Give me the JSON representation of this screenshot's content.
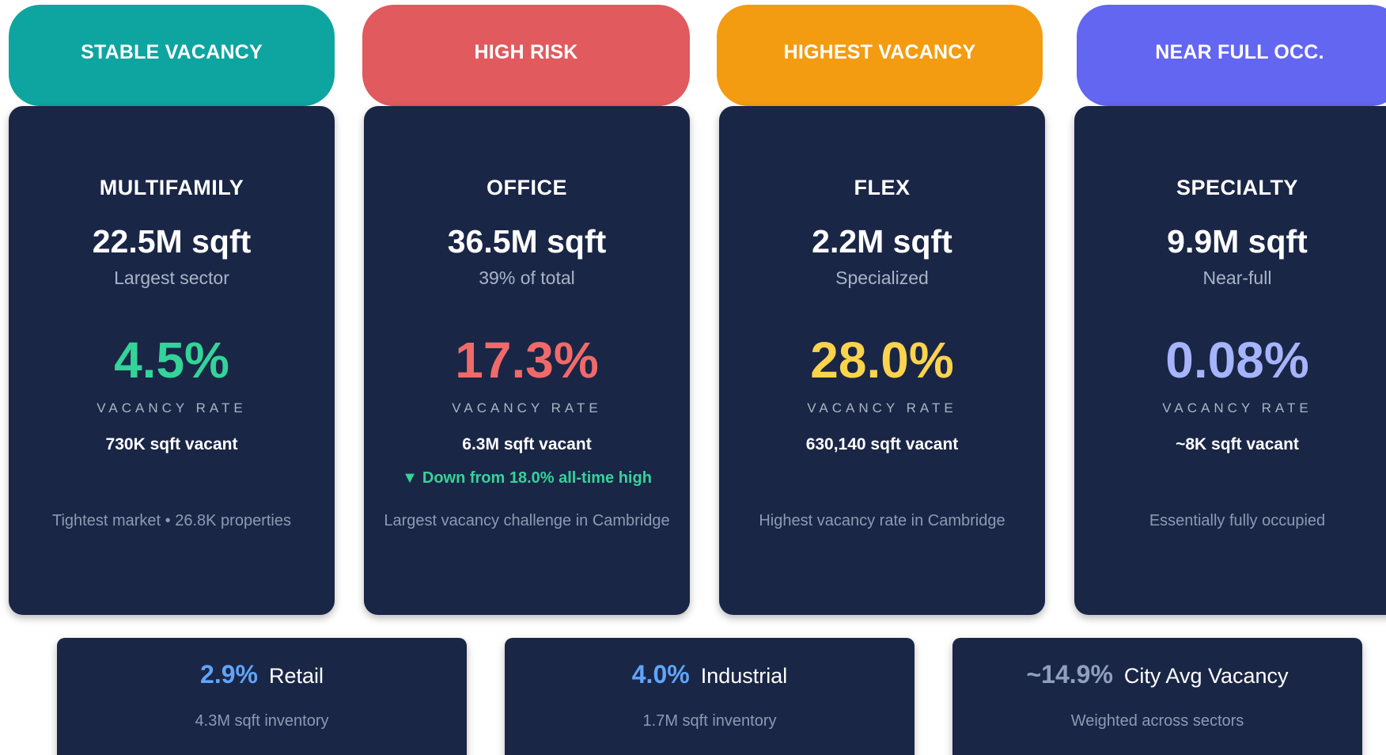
{
  "tags": [
    {
      "label": "STABLE VACANCY",
      "color": "#0ea5a0"
    },
    {
      "label": "HIGH RISK",
      "color": "#e05a5e"
    },
    {
      "label": "HIGHEST VACANCY",
      "color": "#f39c12"
    },
    {
      "label": "NEAR FULL OCC.",
      "color": "#6366f1"
    }
  ],
  "cards": [
    {
      "title": "MULTIFAMILY",
      "size": "22.5M sqft",
      "note": "Largest sector",
      "rate": "4.5%",
      "rate_color": "#34d399",
      "rate_label": "VACANCY RATE",
      "vacant": "730K sqft vacant",
      "trend": "",
      "footnote": "Tightest market • 26.8K properties"
    },
    {
      "title": "OFFICE",
      "size": "36.5M sqft",
      "note": "39% of total",
      "rate": "17.3%",
      "rate_color": "#f06a6a",
      "rate_label": "VACANCY RATE",
      "vacant": "6.3M sqft vacant",
      "trend": "Down from 18.0% all-time high",
      "trend_icon": "triangle-down-icon",
      "footnote": "Largest vacancy challenge in Cambridge"
    },
    {
      "title": "FLEX",
      "size": "2.2M sqft",
      "note": "Specialized",
      "rate": "28.0%",
      "rate_color": "#fcd34d",
      "rate_label": "VACANCY RATE",
      "vacant": "630,140 sqft vacant",
      "trend": "",
      "footnote": "Highest vacancy rate in Cambridge"
    },
    {
      "title": "SPECIALTY",
      "size": "9.9M sqft",
      "note": "Near-full",
      "rate": "0.08%",
      "rate_color": "#a5b4fc",
      "rate_label": "VACANCY RATE",
      "vacant": "~8K sqft vacant",
      "trend": "",
      "footnote": "Essentially fully occupied"
    }
  ],
  "bottom": [
    {
      "value": "2.9%",
      "name": "Retail",
      "sub": "4.3M sqft inventory"
    },
    {
      "value": "4.0%",
      "name": "Industrial",
      "sub": "1.7M sqft inventory"
    },
    {
      "value": "~14.9%",
      "name": "City Avg Vacancy",
      "sub": "Weighted across sectors"
    }
  ],
  "colors": {
    "card_bg": "#1a2646",
    "bottom_value": "#60a5fa",
    "muted_text": "#a9b4c8"
  }
}
